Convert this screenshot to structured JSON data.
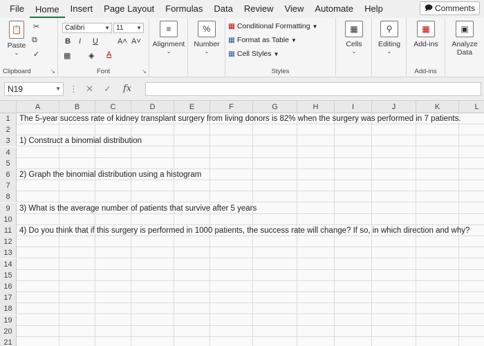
{
  "menu": {
    "tabs": [
      "File",
      "Home",
      "Insert",
      "Page Layout",
      "Formulas",
      "Data",
      "Review",
      "View",
      "Automate",
      "Help"
    ],
    "active": "Home",
    "comments_label": "Comments"
  },
  "ribbon": {
    "clipboard": {
      "paste_label": "Paste",
      "group_label": "Clipboard"
    },
    "font": {
      "font_name": "Calibri",
      "font_size": "11",
      "bold": "B",
      "italic": "I",
      "underline": "U",
      "grow": "A˄",
      "shrink": "A˅",
      "group_label": "Font"
    },
    "alignment": {
      "label": "Alignment"
    },
    "number": {
      "label": "Number",
      "symbol": "%"
    },
    "styles": {
      "conditional": "Conditional Formatting",
      "format_table": "Format as Table",
      "cell_styles": "Cell Styles",
      "group_label": "Styles"
    },
    "cells": {
      "label": "Cells"
    },
    "editing": {
      "label": "Editing"
    },
    "addins": {
      "label": "Add-ins",
      "group_label": "Add-ins"
    },
    "analyze": {
      "line1": "Analyze",
      "line2": "Data"
    }
  },
  "formula_bar": {
    "name_box": "N19",
    "fx": "fx",
    "value": ""
  },
  "grid": {
    "columns": [
      "A",
      "B",
      "C",
      "D",
      "E",
      "F",
      "G",
      "H",
      "I",
      "J",
      "K",
      "L"
    ],
    "rows": [
      {
        "n": "1",
        "text": "The 5-year success rate of kidney transplant surgery from living donors is 82% when the surgery was performed in 7 patients."
      },
      {
        "n": "2",
        "text": ""
      },
      {
        "n": "3",
        "text": "1) Construct a binomial distribution"
      },
      {
        "n": "4",
        "text": ""
      },
      {
        "n": "5",
        "text": ""
      },
      {
        "n": "6",
        "text": "2) Graph the binomial distribution using a histogram"
      },
      {
        "n": "7",
        "text": ""
      },
      {
        "n": "8",
        "text": ""
      },
      {
        "n": "9",
        "text": "3) What is the average number of patients that survive after 5 years"
      },
      {
        "n": "10",
        "text": ""
      },
      {
        "n": "11",
        "text": "4) Do you think that if this surgery is performed in 1000 patients, the success rate will change? If so, in which direction and why?"
      },
      {
        "n": "12",
        "text": ""
      },
      {
        "n": "13",
        "text": ""
      },
      {
        "n": "14",
        "text": ""
      },
      {
        "n": "15",
        "text": ""
      },
      {
        "n": "16",
        "text": ""
      },
      {
        "n": "17",
        "text": ""
      },
      {
        "n": "18",
        "text": ""
      },
      {
        "n": "19",
        "text": ""
      },
      {
        "n": "20",
        "text": ""
      },
      {
        "n": "21",
        "text": ""
      }
    ]
  },
  "colors": {
    "accent": "#1e7145"
  }
}
